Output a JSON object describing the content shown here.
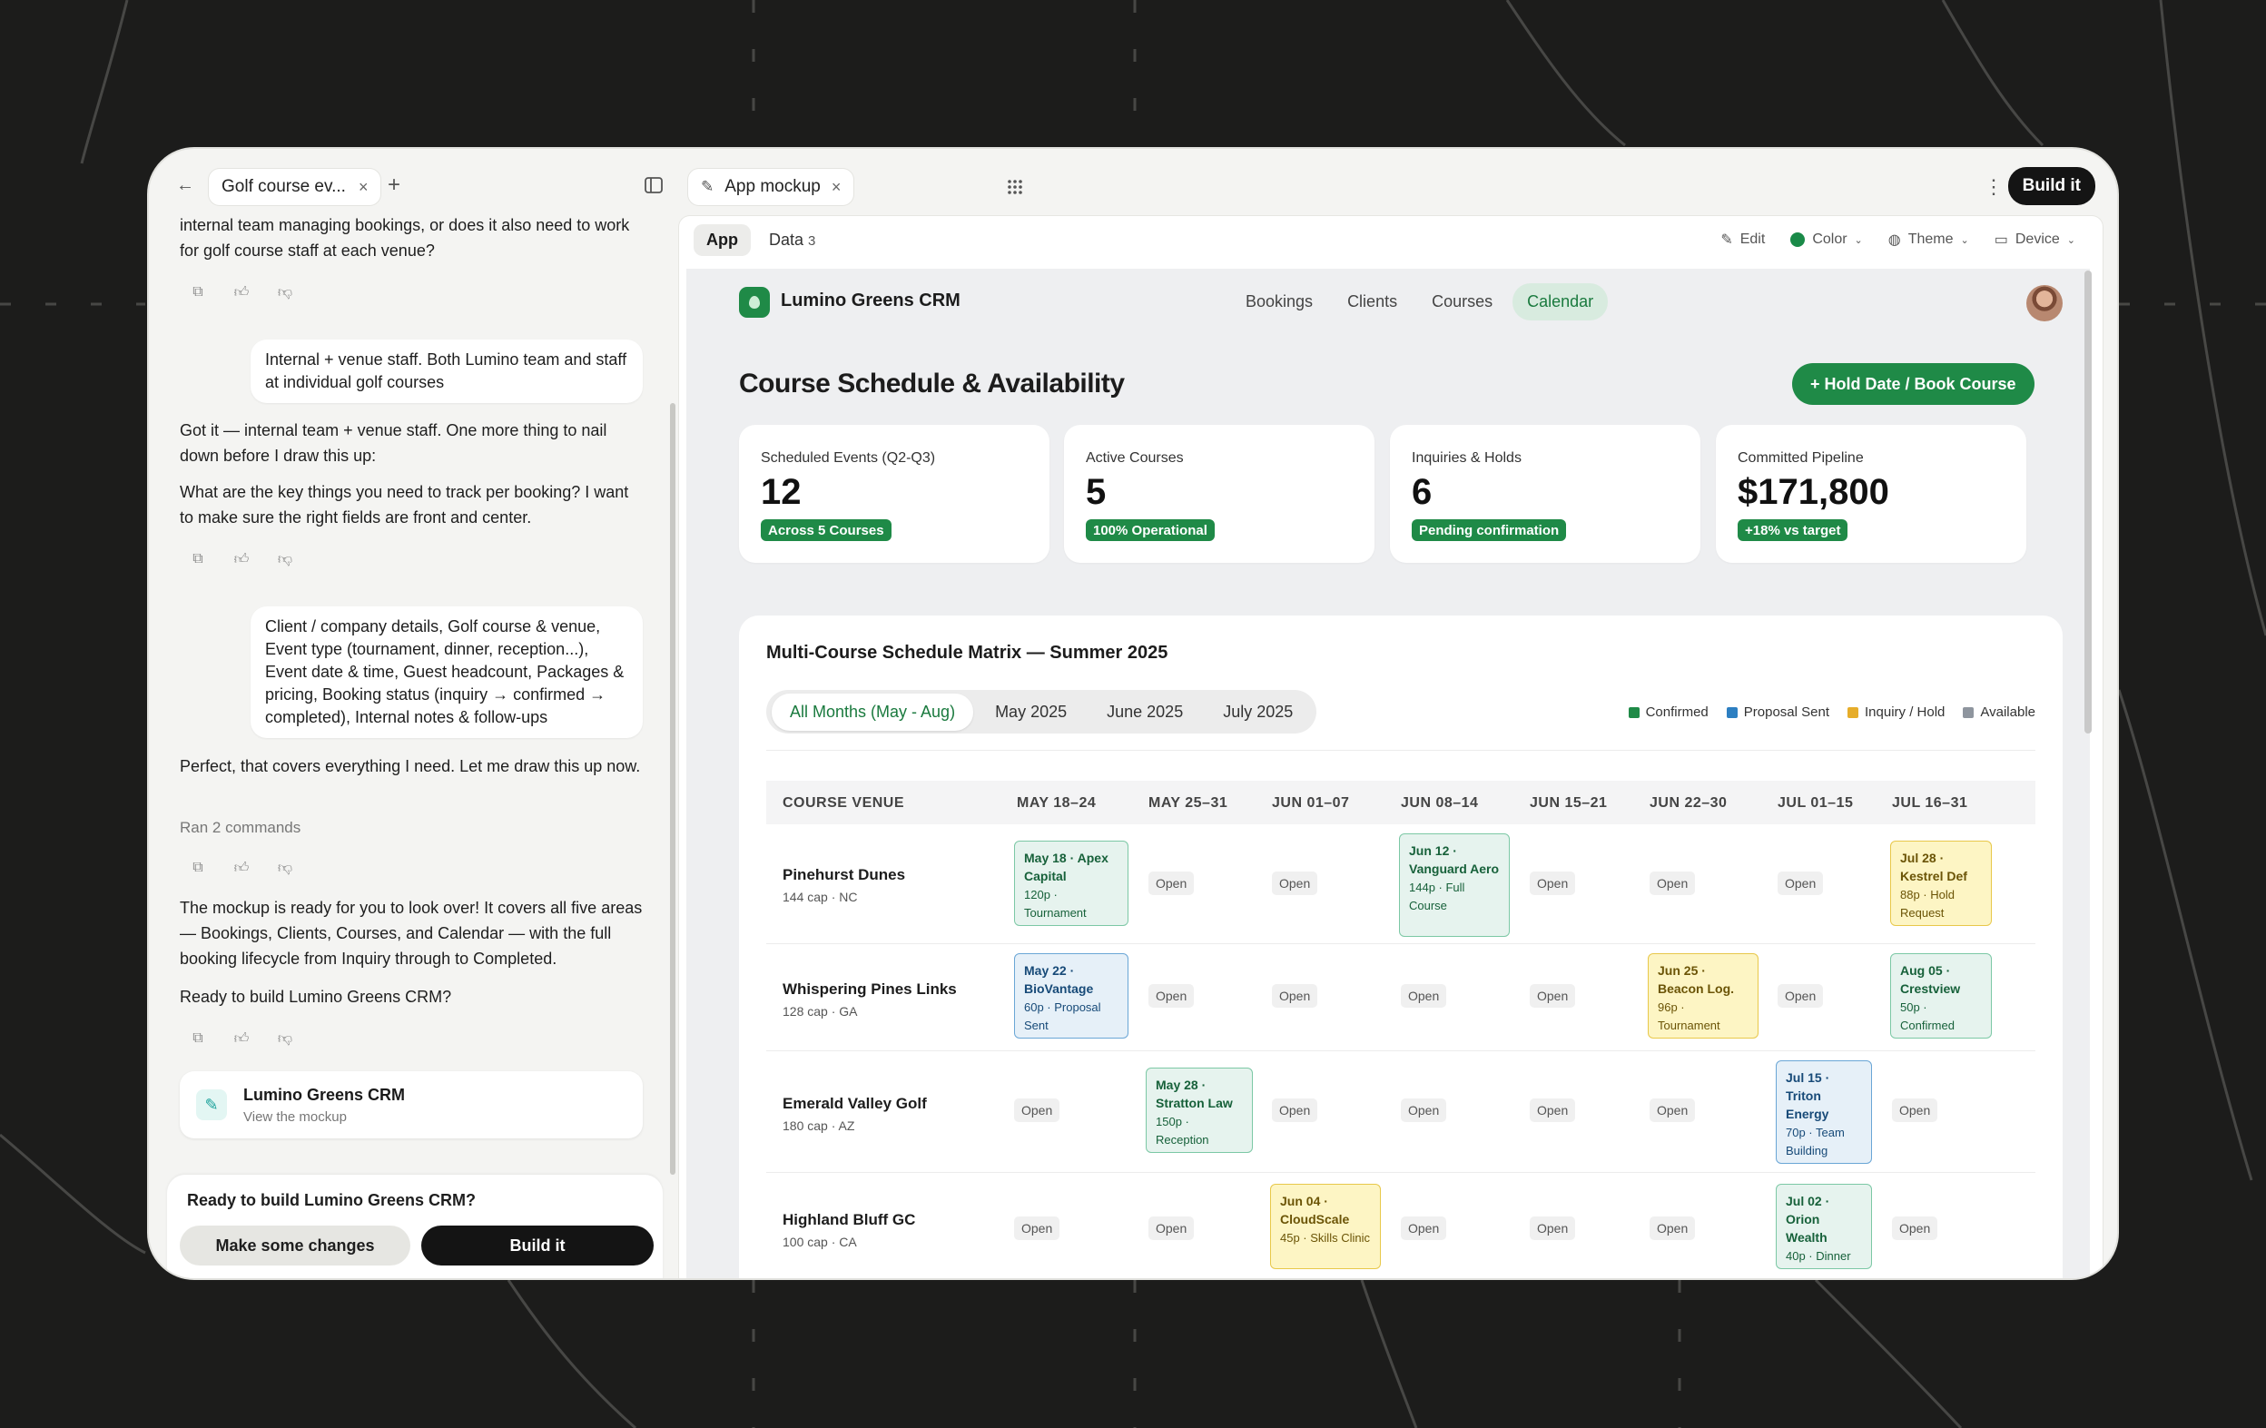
{
  "left": {
    "tab_title": "Golf course ev...",
    "messages": {
      "m1": "internal team managing bookings, or does it also need to work for golf course staff at each venue?",
      "u1": "Internal + venue staff. Both Lumino team and staff at individual golf courses",
      "m2a": "Got it — internal team + venue staff. One more thing to nail down before I draw this up:",
      "m2b": "What are the key things you need to track per booking? I want to make sure the right fields are front and center.",
      "u2": "Client / company details, Golf course & venue, Event type (tournament, dinner, reception...), Event date & time, Guest headcount, Packages & pricing, Booking status (inquiry → confirmed → completed), Internal notes & follow-ups",
      "m3": "Perfect, that covers everything I need. Let me draw this up now.",
      "ran": "Ran 2 commands",
      "m4": "The mockup is ready for you to look over! It covers all five areas — Bookings, Clients, Courses, and Calendar — with the full booking lifecycle from Inquiry through to Completed.",
      "m5": "Ready to build Lumino Greens CRM?"
    },
    "artifact": {
      "title": "Lumino Greens CRM",
      "subtitle": "View the mockup"
    },
    "prompt": {
      "question": "Ready to build Lumino Greens CRM?",
      "secondary": "Make some changes",
      "primary": "Build it"
    }
  },
  "right": {
    "tab_title": "App mockup",
    "build_label": "Build it",
    "toolbar": {
      "app": "App",
      "data": "Data",
      "data_count": "3",
      "edit": "Edit",
      "color": "Color",
      "theme": "Theme",
      "device": "Device"
    }
  },
  "app": {
    "brand": "Lumino Greens CRM",
    "nav": [
      "Bookings",
      "Clients",
      "Courses",
      "Calendar"
    ],
    "page_title": "Course Schedule & Availability",
    "cta": "+ Hold Date / Book Course",
    "stats": [
      {
        "label": "Scheduled Events (Q2-Q3)",
        "value": "12",
        "badge": "Across 5 Courses"
      },
      {
        "label": "Active Courses",
        "value": "5",
        "badge": "100% Operational"
      },
      {
        "label": "Inquiries & Holds",
        "value": "6",
        "badge": "Pending confirmation"
      },
      {
        "label": "Committed Pipeline",
        "value": "$171,800",
        "badge": "+18% vs target"
      }
    ],
    "matrix": {
      "title": "Multi-Course Schedule Matrix — Summer 2025",
      "filters": [
        "All Months (May - Aug)",
        "May 2025",
        "June 2025",
        "July 2025"
      ],
      "legend": [
        {
          "label": "Confirmed",
          "color": "#1f8a47"
        },
        {
          "label": "Proposal Sent",
          "color": "#2d7fc1"
        },
        {
          "label": "Inquiry / Hold",
          "color": "#e6ad2a"
        },
        {
          "label": "Available",
          "color": "#8e959e"
        }
      ],
      "columns": [
        "COURSE VENUE",
        "MAY 18–24",
        "MAY 25–31",
        "JUN 01–07",
        "JUN 08–14",
        "JUN 15–21",
        "JUN 22–30",
        "JUL 01–15",
        "JUL 16–31"
      ],
      "open_label": "Open",
      "rows": [
        {
          "name": "Pinehurst Dunes",
          "cap": "144 cap · NC"
        },
        {
          "name": "Whispering Pines Links",
          "cap": "128 cap · GA"
        },
        {
          "name": "Emerald Valley Golf",
          "cap": "180 cap · AZ"
        },
        {
          "name": "Highland Bluff GC",
          "cap": "100 cap · CA"
        }
      ],
      "events": {
        "r0c1": {
          "title": "May 18 · Apex Capital",
          "sub": "120p · Tournament"
        },
        "r0c4": {
          "title": "Jun 12 · Vanguard Aero",
          "sub": "144p · Full Course"
        },
        "r0c8": {
          "title": "Jul 28 · Kestrel Def",
          "sub": "88p · Hold Request"
        },
        "r1c1": {
          "title": "May 22 · BioVantage",
          "sub": "60p · Proposal Sent"
        },
        "r1c6": {
          "title": "Jun 25 · Beacon Log.",
          "sub": "96p · Tournament"
        },
        "r1c8": {
          "title": "Aug 05 · Crestview",
          "sub": "50p · Confirmed"
        },
        "r2c2": {
          "title": "May 28 · Stratton Law",
          "sub": "150p · Reception"
        },
        "r2c7": {
          "title": "Jul 15 · Triton Energy",
          "sub": "70p · Team Building"
        },
        "r3c3": {
          "title": "Jun 04 · CloudScale",
          "sub": "45p · Skills Clinic"
        },
        "r3c7": {
          "title": "Jul 02 · Orion Wealth",
          "sub": "40p · Dinner"
        }
      }
    }
  }
}
